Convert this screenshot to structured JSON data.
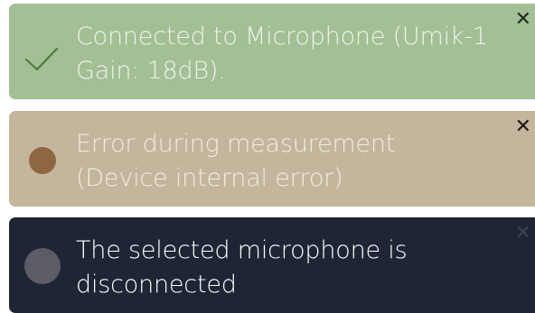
{
  "toasts": [
    {
      "type": "success",
      "icon": "checkmark-icon",
      "message": "Connected to Microphone (Umik-1 Gain: 18dB).",
      "close_label": "✕",
      "color": "#a2bf95"
    },
    {
      "type": "error",
      "icon": "status-dot-icon",
      "message": "Error during measurement (Device internal error)",
      "close_label": "✕",
      "color": "#c4b69c"
    },
    {
      "type": "info",
      "icon": "status-dot-icon",
      "message": "The selected microphone is disconnected",
      "close_label": "✕",
      "color": "#1e2535"
    }
  ]
}
